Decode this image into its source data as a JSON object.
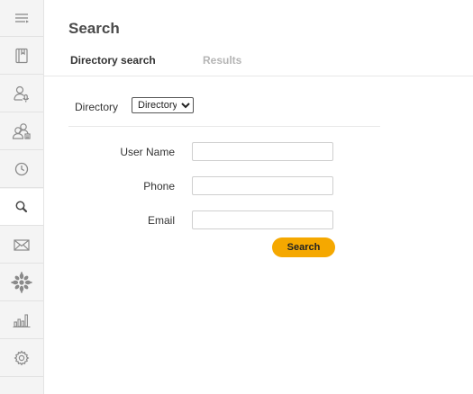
{
  "sidebar": {
    "items": [
      {
        "icon": "menu-icon",
        "active": false
      },
      {
        "icon": "book-icon",
        "active": false
      },
      {
        "icon": "user-microphone-icon",
        "active": false
      },
      {
        "icon": "users-icon",
        "active": false
      },
      {
        "icon": "clock-icon",
        "active": false
      },
      {
        "icon": "search-icon",
        "active": true
      },
      {
        "icon": "mail-icon",
        "active": false
      },
      {
        "icon": "network-icon",
        "active": false
      },
      {
        "icon": "bar-chart-icon",
        "active": false
      },
      {
        "icon": "gear-icon",
        "active": false
      }
    ]
  },
  "header": {
    "title": "Search",
    "tabs": [
      {
        "label": "Directory search",
        "active": true
      },
      {
        "label": "Results",
        "active": false
      }
    ]
  },
  "directory": {
    "label": "Directory",
    "selected": "Directory"
  },
  "form": {
    "user_name_label": "User Name",
    "user_name_value": "",
    "phone_label": "Phone",
    "phone_value": "",
    "email_label": "Email",
    "email_value": "",
    "search_button": "Search"
  },
  "colors": {
    "accent": "#f5a800",
    "sidebar_bg": "#f4f4f4",
    "icon": "#8a8a8a",
    "inactive_tab": "#b5b5b5"
  }
}
